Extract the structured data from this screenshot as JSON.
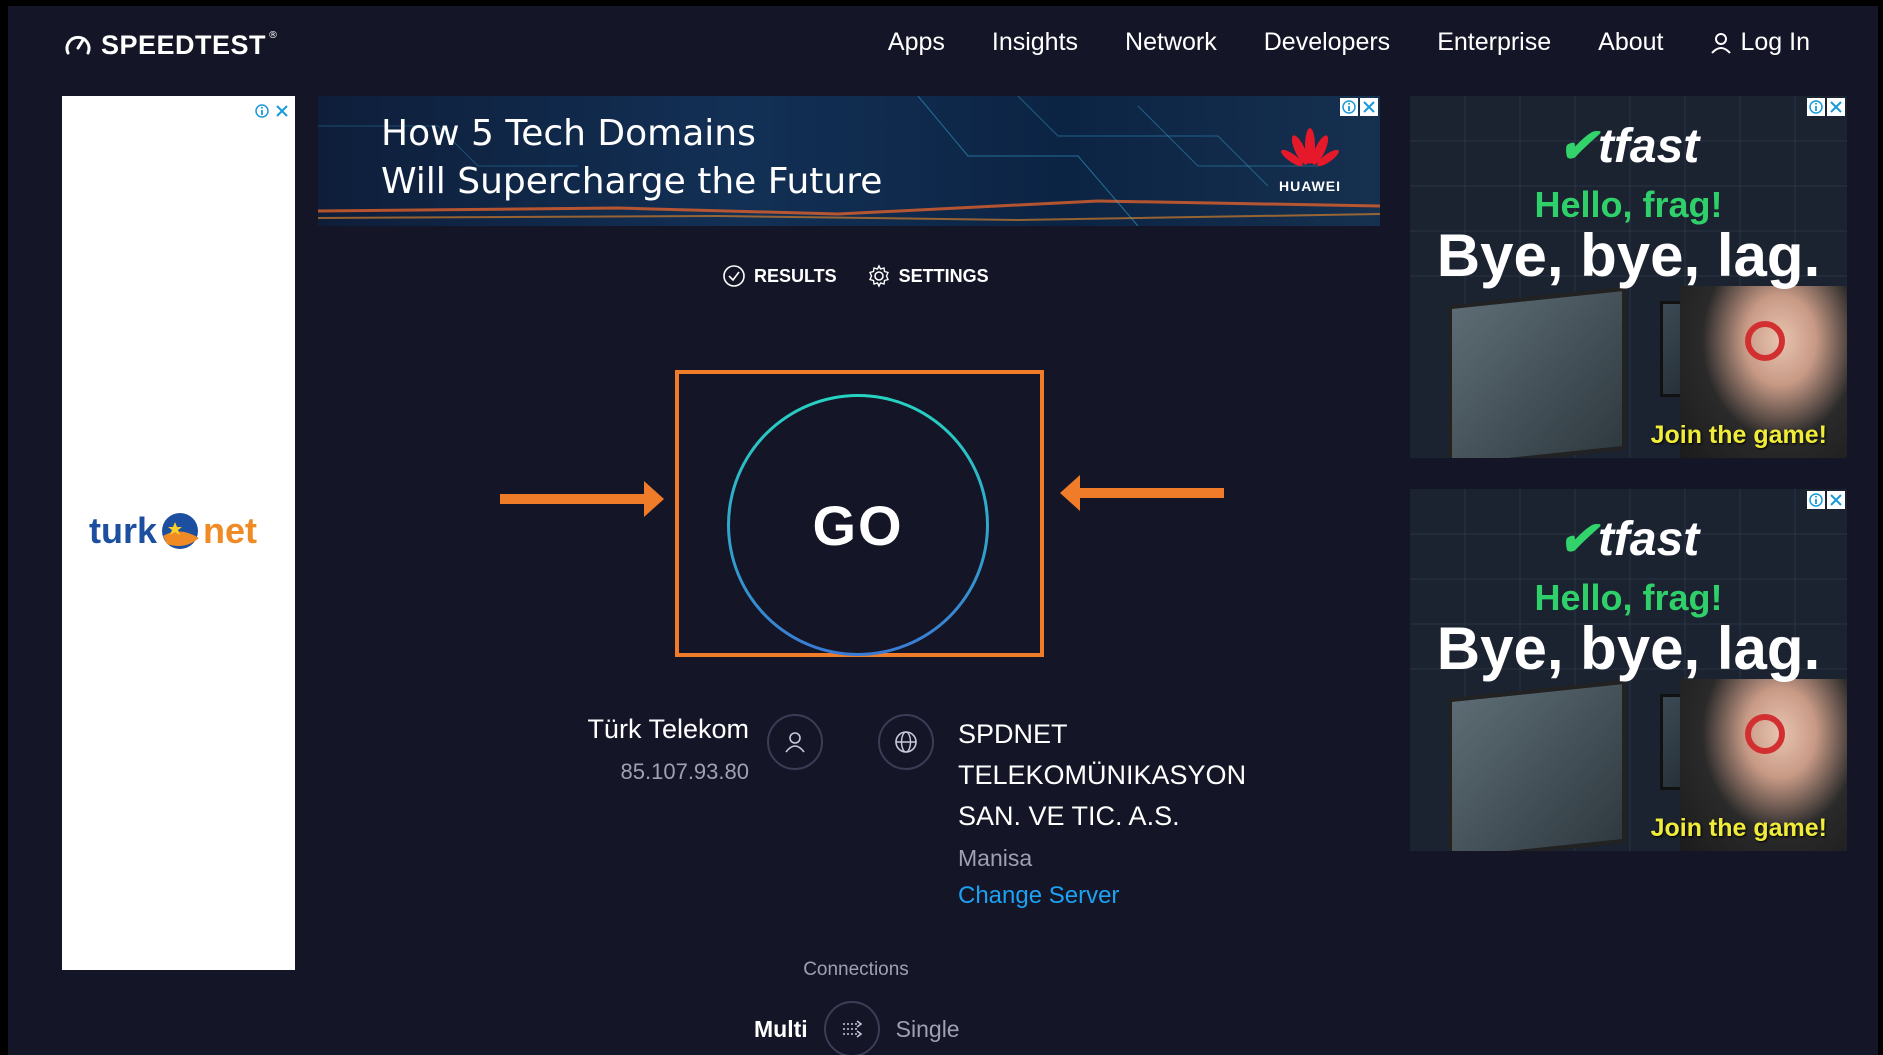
{
  "header": {
    "logo_text": "SPEEDTEST",
    "logo_mark": "®",
    "nav": [
      "Apps",
      "Insights",
      "Network",
      "Developers",
      "Enterprise",
      "About"
    ],
    "login_label": "Log In"
  },
  "ads": {
    "left": {
      "brand_part1": "turk",
      "brand_part2": "net"
    },
    "top": {
      "line1": "How 5 Tech Domains",
      "line2": "Will Supercharge the Future",
      "brand": "HUAWEI"
    },
    "right": {
      "brand": "tfast",
      "hello": "Hello, frag!",
      "tagline": "Bye, bye, lag.",
      "cta": "Join the game!"
    }
  },
  "tabs": {
    "results": "RESULTS",
    "settings": "SETTINGS"
  },
  "go": {
    "label": "GO"
  },
  "isp": {
    "name": "Türk Telekom",
    "ip": "85.107.93.80"
  },
  "server": {
    "name": "SPDNET TELEKOMÜNIKASYON SAN. VE TIC. A.S.",
    "location": "Manisa",
    "change_label": "Change Server"
  },
  "connections": {
    "label": "Connections",
    "multi": "Multi",
    "single": "Single"
  },
  "colors": {
    "background": "#141526",
    "highlight": "#f07c2a",
    "go_ring_start": "#26d3c1",
    "go_ring_end": "#3a7bd5",
    "link": "#1da1f2",
    "muted_text": "#9ea1b3"
  },
  "icons": {
    "logo": "speedometer-icon",
    "login": "user-icon",
    "results": "check-circle-icon",
    "settings": "gear-icon",
    "isp": "user-icon",
    "server": "globe-icon",
    "connections": "arrows-icon",
    "ad": [
      "info-icon",
      "close-icon"
    ]
  }
}
